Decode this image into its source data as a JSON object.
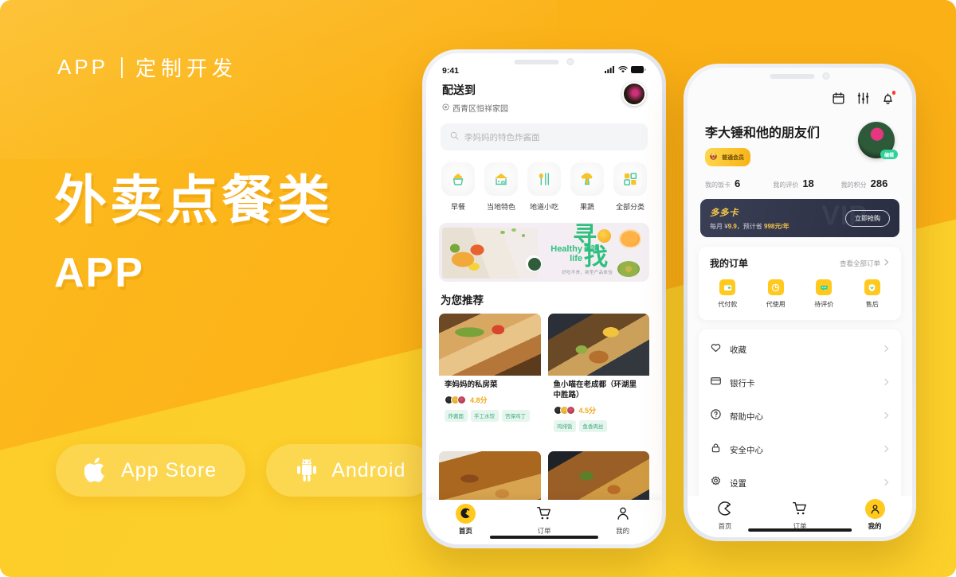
{
  "promo": {
    "kicker_en": "APP",
    "kicker_divider": "|",
    "kicker_cn": "定制开发",
    "headline": "外卖点餐类",
    "subline": "APP",
    "stores": [
      {
        "label": "App Store",
        "icon": "apple-icon"
      },
      {
        "label": "Android",
        "icon": "android-icon"
      }
    ],
    "colors": {
      "bg_top": "#FBB016",
      "bg_bottom": "#FCD02A",
      "accent": "#FFC91E"
    }
  },
  "phone1": {
    "status": {
      "time": "9:41",
      "signal": "signal-icon",
      "wifi": "wifi-icon",
      "battery": "battery-icon"
    },
    "header": {
      "deliver_label": "配送到",
      "address": "西青区恒祥家园",
      "avatar": "user-avatar"
    },
    "search": {
      "placeholder": "李妈妈的特色炸酱面",
      "icon": "search-icon"
    },
    "categories": [
      {
        "label": "早餐",
        "icon": "cupcake-icon"
      },
      {
        "label": "当地特色",
        "icon": "house-icon"
      },
      {
        "label": "地道小吃",
        "icon": "spoon-chopsticks-icon"
      },
      {
        "label": "果蔬",
        "icon": "broccoli-icon"
      },
      {
        "label": "全部分类",
        "icon": "grid-icon"
      }
    ],
    "banner": {
      "cn_big_1": "寻",
      "cn_big_2": "找",
      "en_line1": "Healthy",
      "en_line2": "life",
      "cn_small": "美味",
      "tagline": "好吃不贵，新型产品体验"
    },
    "section_title": "为您推荐",
    "cards": [
      {
        "name": "李妈妈的私房菜",
        "rating": "4.8分",
        "tags": [
          "炸酱面",
          "手工水饺",
          "宫保鸡丁"
        ],
        "image": "burrito-photo"
      },
      {
        "name": "鱼小喵在老成都（环湖里中胜路）",
        "rating": "4.5分",
        "tags": [
          "鸡排饭",
          "鱼香肉丝"
        ],
        "image": "ricebowl-photo"
      },
      {
        "name": "",
        "rating": "",
        "tags": [],
        "image": "ribs-photo"
      },
      {
        "name": "",
        "rating": "",
        "tags": [],
        "image": "vegetable-photo"
      }
    ],
    "tabs": [
      {
        "label": "首页",
        "icon": "pacman-icon",
        "active": true
      },
      {
        "label": "订单",
        "icon": "cart-icon",
        "active": false
      },
      {
        "label": "我的",
        "icon": "person-icon",
        "active": false
      }
    ]
  },
  "phone2": {
    "top_icons": [
      "calendar-icon",
      "sliders-icon",
      "bell-icon"
    ],
    "user": {
      "name": "李大锤和他的朋友们",
      "badge": "普通会员",
      "badge_icon": "crown-face-icon",
      "avatar": "user-avatar",
      "edit_label": "编辑"
    },
    "stats": [
      {
        "label": "我的饭卡",
        "value": "6"
      },
      {
        "label": "我的评价",
        "value": "18"
      },
      {
        "label": "我的积分",
        "value": "286"
      }
    ],
    "vip_card": {
      "title": "多多卡",
      "subtitle_pre": "每月 ¥",
      "price": "9.9",
      "subtitle_mid": "，预计省 ",
      "save": "998元/年",
      "button": "立即抢购",
      "watermark": "VIP"
    },
    "orders": {
      "title": "我的订单",
      "more": "查看全部订单",
      "items": [
        {
          "label": "代付款",
          "icon": "wallet-icon"
        },
        {
          "label": "代使用",
          "icon": "clock-icon"
        },
        {
          "label": "待评价",
          "icon": "comment-icon"
        },
        {
          "label": "售后",
          "icon": "aftersale-icon"
        }
      ]
    },
    "menu": [
      {
        "label": "收藏",
        "icon": "heart-icon"
      },
      {
        "label": "银行卡",
        "icon": "card-icon"
      },
      {
        "label": "帮助中心",
        "icon": "question-icon"
      },
      {
        "label": "安全中心",
        "icon": "lock-icon"
      },
      {
        "label": "设置",
        "icon": "gear-icon"
      }
    ],
    "tabs": [
      {
        "label": "首页",
        "icon": "pacman-icon",
        "active": false
      },
      {
        "label": "订单",
        "icon": "cart-icon",
        "active": false
      },
      {
        "label": "我的",
        "icon": "person-icon",
        "active": true
      }
    ]
  }
}
